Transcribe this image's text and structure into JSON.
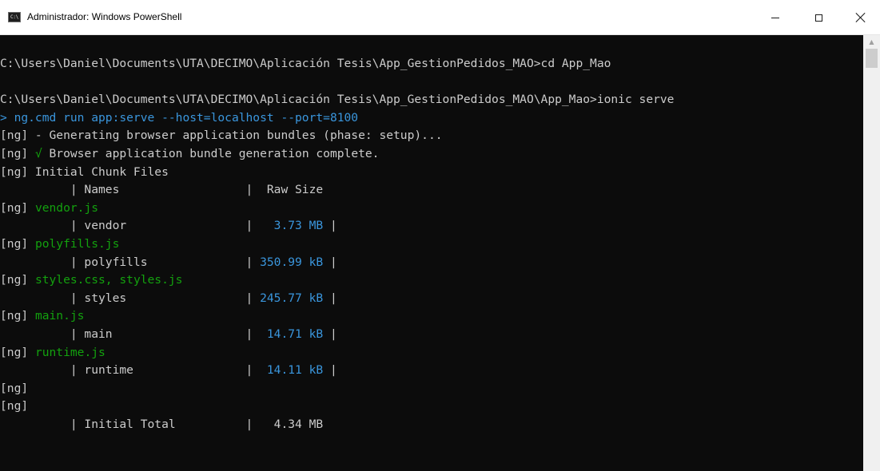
{
  "window": {
    "title": "Administrador: Windows PowerShell",
    "icon": "powershell-console-icon",
    "icon_text": "C:\\",
    "controls": {
      "minimize": "minimize-icon",
      "maximize": "maximize-icon",
      "close": "close-icon"
    }
  },
  "console": {
    "colors": {
      "background": "#0c0c0c",
      "text": "#cccccc",
      "green": "#13a10e",
      "blue": "#3a96dd"
    },
    "lines": [
      [
        {
          "t": "C:\\Users\\Daniel\\Documents\\UTA\\DECIMO\\Aplicación Tesis\\App_GestionPedidos_MAO>cd App_Mao",
          "c": "w"
        }
      ],
      [
        {
          "t": "",
          "c": "w"
        }
      ],
      [
        {
          "t": "C:\\Users\\Daniel\\Documents\\UTA\\DECIMO\\Aplicación Tesis\\App_GestionPedidos_MAO\\App_Mao>ionic serve",
          "c": "w"
        }
      ],
      [
        {
          "t": "> ng.cmd run app:serve --host=localhost --port=8100",
          "c": "c"
        }
      ],
      [
        {
          "t": "[ng] - Generating browser application bundles (phase: setup)...",
          "c": "w"
        }
      ],
      [
        {
          "t": "[ng] ",
          "c": "w"
        },
        {
          "t": "√",
          "c": "g"
        },
        {
          "t": " Browser application bundle generation complete.",
          "c": "w"
        }
      ],
      [
        {
          "t": "[ng] Initial Chunk Files",
          "c": "w"
        }
      ],
      [
        {
          "t": "          | Names                  |  Raw Size",
          "c": "w"
        }
      ],
      [
        {
          "t": "[ng] ",
          "c": "w"
        },
        {
          "t": "vendor.js",
          "c": "g"
        }
      ],
      [
        {
          "t": "          | vendor                 |   ",
          "c": "w"
        },
        {
          "t": "3.73 MB",
          "c": "cy"
        },
        {
          "t": " |",
          "c": "w"
        }
      ],
      [
        {
          "t": "[ng] ",
          "c": "w"
        },
        {
          "t": "polyfills.js",
          "c": "g"
        }
      ],
      [
        {
          "t": "          | polyfills              | ",
          "c": "w"
        },
        {
          "t": "350.99 kB",
          "c": "cy"
        },
        {
          "t": " |",
          "c": "w"
        }
      ],
      [
        {
          "t": "[ng] ",
          "c": "w"
        },
        {
          "t": "styles.css, styles.js",
          "c": "g"
        }
      ],
      [
        {
          "t": "          | styles                 | ",
          "c": "w"
        },
        {
          "t": "245.77 kB",
          "c": "cy"
        },
        {
          "t": " |",
          "c": "w"
        }
      ],
      [
        {
          "t": "[ng] ",
          "c": "w"
        },
        {
          "t": "main.js",
          "c": "g"
        }
      ],
      [
        {
          "t": "          | main                   |  ",
          "c": "w"
        },
        {
          "t": "14.71 kB",
          "c": "cy"
        },
        {
          "t": " |",
          "c": "w"
        }
      ],
      [
        {
          "t": "[ng] ",
          "c": "w"
        },
        {
          "t": "runtime.js",
          "c": "g"
        }
      ],
      [
        {
          "t": "          | runtime                |  ",
          "c": "w"
        },
        {
          "t": "14.11 kB",
          "c": "cy"
        },
        {
          "t": " |",
          "c": "w"
        }
      ],
      [
        {
          "t": "[ng]",
          "c": "w"
        }
      ],
      [
        {
          "t": "[ng]",
          "c": "w"
        }
      ],
      [
        {
          "t": "          | Initial Total          |   4.34 MB",
          "c": "w"
        }
      ]
    ]
  },
  "scrollbar": {
    "up_arrow": "chevron-up-icon",
    "position": 0
  }
}
